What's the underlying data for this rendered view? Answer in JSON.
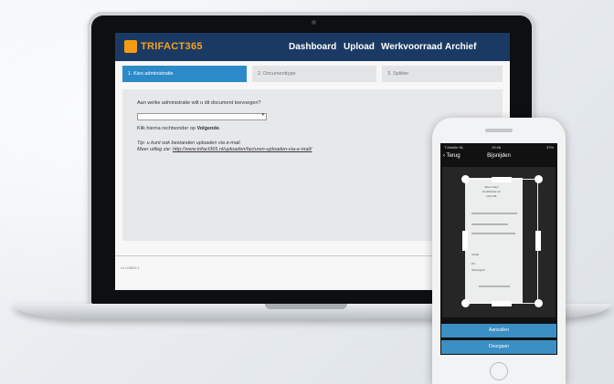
{
  "app": {
    "logo_text": "TRIFACT365",
    "nav": [
      "Dashboard",
      "Upload",
      "Werkvoorraad",
      "Archief"
    ]
  },
  "steps": [
    "1. Kies administratie",
    "2. Documenttype",
    "3. Splitter"
  ],
  "form": {
    "question": "Aan welke administratie wilt u dit document toevoegen?",
    "select_value": "",
    "instruction_prefix": "Klik hierna rechtsonder op ",
    "instruction_bold": "Volgende",
    "instruction_suffix": ".",
    "tip": "Tip: u kunt ook bestanden uploaden via e-mail.",
    "tip_more_prefix": "Meer uitleg zie: ",
    "tip_link": "http://www.trifact365.nl/uploaden/facturen-uploaden-via-e-mail/"
  },
  "footer": {
    "version": "v1.0.8902.1"
  },
  "phone": {
    "status_carrier": "T-Mobile NL",
    "status_time": "19:46",
    "status_battery": "37%",
    "back_label": "Terug",
    "title": "Bijsnijden",
    "receipt_lines": [
      "Albert Heijn",
      "Hoofdstraat 12",
      "1234 AB",
      "Totaal",
      "Pin",
      "Wisselgeld"
    ],
    "buttons": [
      "Aanvullen",
      "Doorgaan"
    ]
  },
  "colors": {
    "header_bg": "#1b3a63",
    "logo_accent": "#f6a21b",
    "active_step": "#2d8ac8",
    "phone_button": "#3a8fc4"
  }
}
